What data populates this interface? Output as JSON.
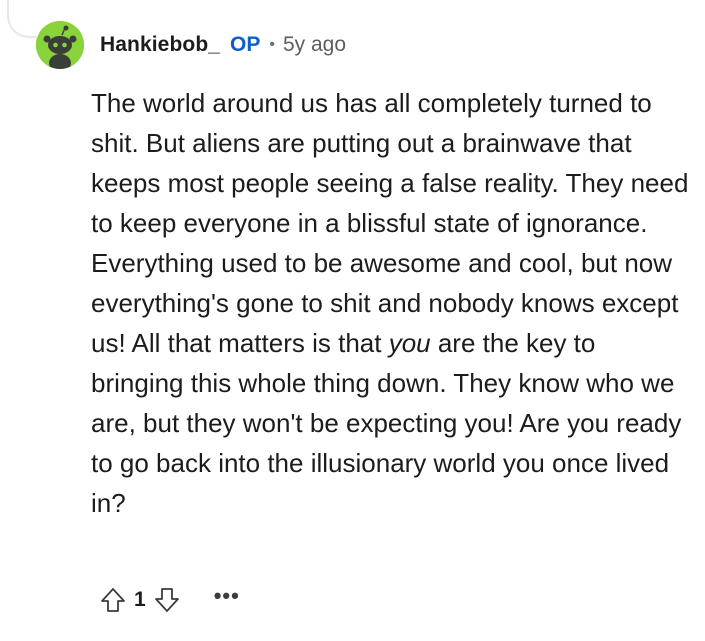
{
  "comment": {
    "author": "Hankiebob_",
    "op_badge": "OP",
    "separator": "•",
    "time_ago": "5y ago",
    "avatar_icon": "snoo-avatar-icon",
    "body_before_em": "The world around us has all completely turned to shit. But aliens are putting out a brainwave that keeps most people seeing a false reality. They need to keep everyone in a blissful state of ignorance. Everything used to be awesome and cool, but now everything's gone to shit and nobody knows except us! All that matters is that ",
    "body_em": "you",
    "body_after_em": " are the key to bringing this whole thing down. They know who we are, but they won't be expecting you! Are you ready to go back into the illusionary world you once lived in?",
    "score": "1",
    "upvote_icon": "upvote-arrow-icon",
    "downvote_icon": "downvote-arrow-icon",
    "more_label": "•••"
  },
  "colors": {
    "avatar_bg": "#8bd33a",
    "op_badge": "#0f5fc9",
    "text": "#1c1c1c",
    "meta": "#5a5f63"
  }
}
